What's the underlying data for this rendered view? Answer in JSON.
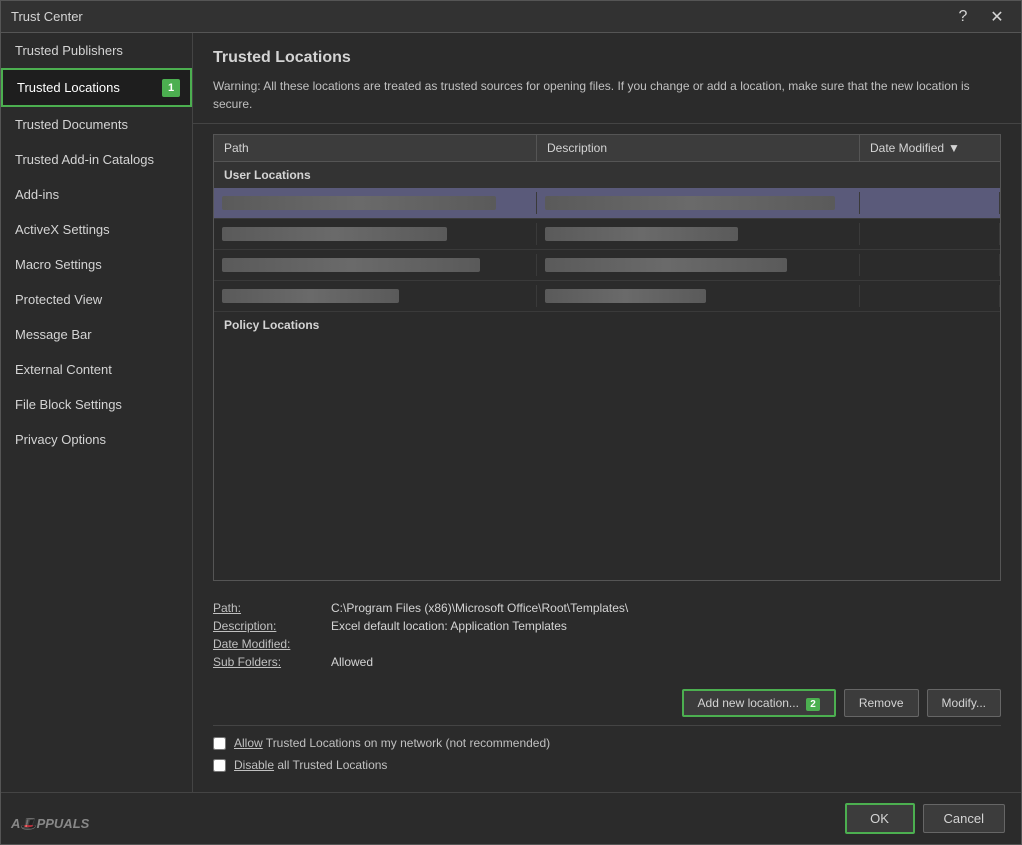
{
  "dialog": {
    "title": "Trust Center"
  },
  "sidebar": {
    "items": [
      {
        "id": "trusted-publishers",
        "label": "Trusted Publishers",
        "active": false
      },
      {
        "id": "trusted-locations",
        "label": "Trusted Locations",
        "active": true,
        "badge": "1"
      },
      {
        "id": "trusted-documents",
        "label": "Trusted Documents",
        "active": false
      },
      {
        "id": "trusted-addins",
        "label": "Trusted Add-in Catalogs",
        "active": false
      },
      {
        "id": "addins",
        "label": "Add-ins",
        "active": false
      },
      {
        "id": "activex",
        "label": "ActiveX Settings",
        "active": false
      },
      {
        "id": "macro",
        "label": "Macro Settings",
        "active": false
      },
      {
        "id": "protected-view",
        "label": "Protected View",
        "active": false
      },
      {
        "id": "message-bar",
        "label": "Message Bar",
        "active": false
      },
      {
        "id": "external-content",
        "label": "External Content",
        "active": false
      },
      {
        "id": "file-block",
        "label": "File Block Settings",
        "active": false
      },
      {
        "id": "privacy",
        "label": "Privacy Options",
        "active": false
      }
    ]
  },
  "panel": {
    "title": "Trusted Locations",
    "warning": "Warning: All these locations are treated as trusted sources for opening files.  If you change or add a location, make sure that the new location is secure.",
    "table": {
      "columns": [
        "Path",
        "Description",
        "Date Modified"
      ],
      "sections": [
        {
          "name": "User Locations",
          "rows": [
            {
              "path": "██████████████████████████████",
              "description": "████████████████████████████████████████",
              "date": ""
            },
            {
              "path": "████████████████████████",
              "description": "████████████████████",
              "date": ""
            },
            {
              "path": "███████████████████████████████",
              "description": "████████████████████████████████",
              "date": ""
            },
            {
              "path": "█████████████████████",
              "description": "████████████████████",
              "date": ""
            }
          ]
        },
        {
          "name": "Policy Locations",
          "rows": []
        }
      ]
    },
    "details": {
      "path_label": "Path:",
      "path_value": "C:\\Program Files (x86)\\Microsoft Office\\Root\\Templates\\",
      "description_label": "Description:",
      "description_value": "Excel default location: Application Templates",
      "date_label": "Date Modified:",
      "date_value": "",
      "subfolders_label": "Sub Folders:",
      "subfolders_value": "Allowed"
    },
    "buttons": {
      "add": "Add new location...",
      "add_badge": "2",
      "remove": "Remove",
      "modify": "Modify..."
    },
    "checkboxes": [
      {
        "id": "allow-network",
        "label_before": "Allow",
        "underline": "Allow",
        "label": "Allow Trusted Locations on my network (not recommended)",
        "checked": false
      },
      {
        "id": "disable-all",
        "label": "Disable all Trusted Locations",
        "checked": false
      }
    ]
  },
  "footer": {
    "ok": "OK",
    "cancel": "Cancel"
  }
}
